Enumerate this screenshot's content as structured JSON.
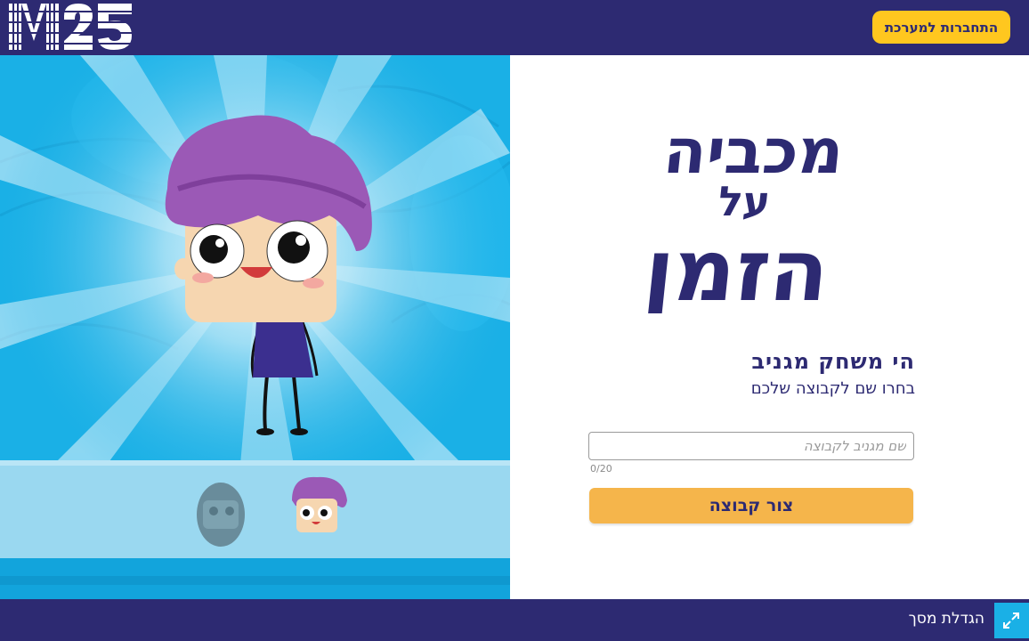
{
  "header": {
    "logo_text": "M25",
    "login_label": "התחברות למערכת"
  },
  "game": {
    "logo_lines": [
      "מכביה",
      "על",
      "הזמן"
    ],
    "headline": "הי משחק מגניב",
    "subline": "בחרו שם לקבוצה שלכם"
  },
  "form": {
    "name_placeholder": "שם מגניב לקבוצה",
    "name_value": "",
    "counter": "0/20",
    "create_label": "צור קבוצה"
  },
  "footer": {
    "fullscreen_label": "הגדלת מסך",
    "fullscreen_icon": "expand-icon"
  },
  "avatars": {
    "options": [
      "avatar-girl",
      "avatar-boy"
    ],
    "selected": "avatar-boy"
  },
  "colors": {
    "brand_navy": "#2d2a72",
    "login_yellow": "#ffc71f",
    "button_orange": "#f5b54b",
    "scene_blue": "#1ab0e6",
    "hair_purple": "#9b59b6"
  }
}
